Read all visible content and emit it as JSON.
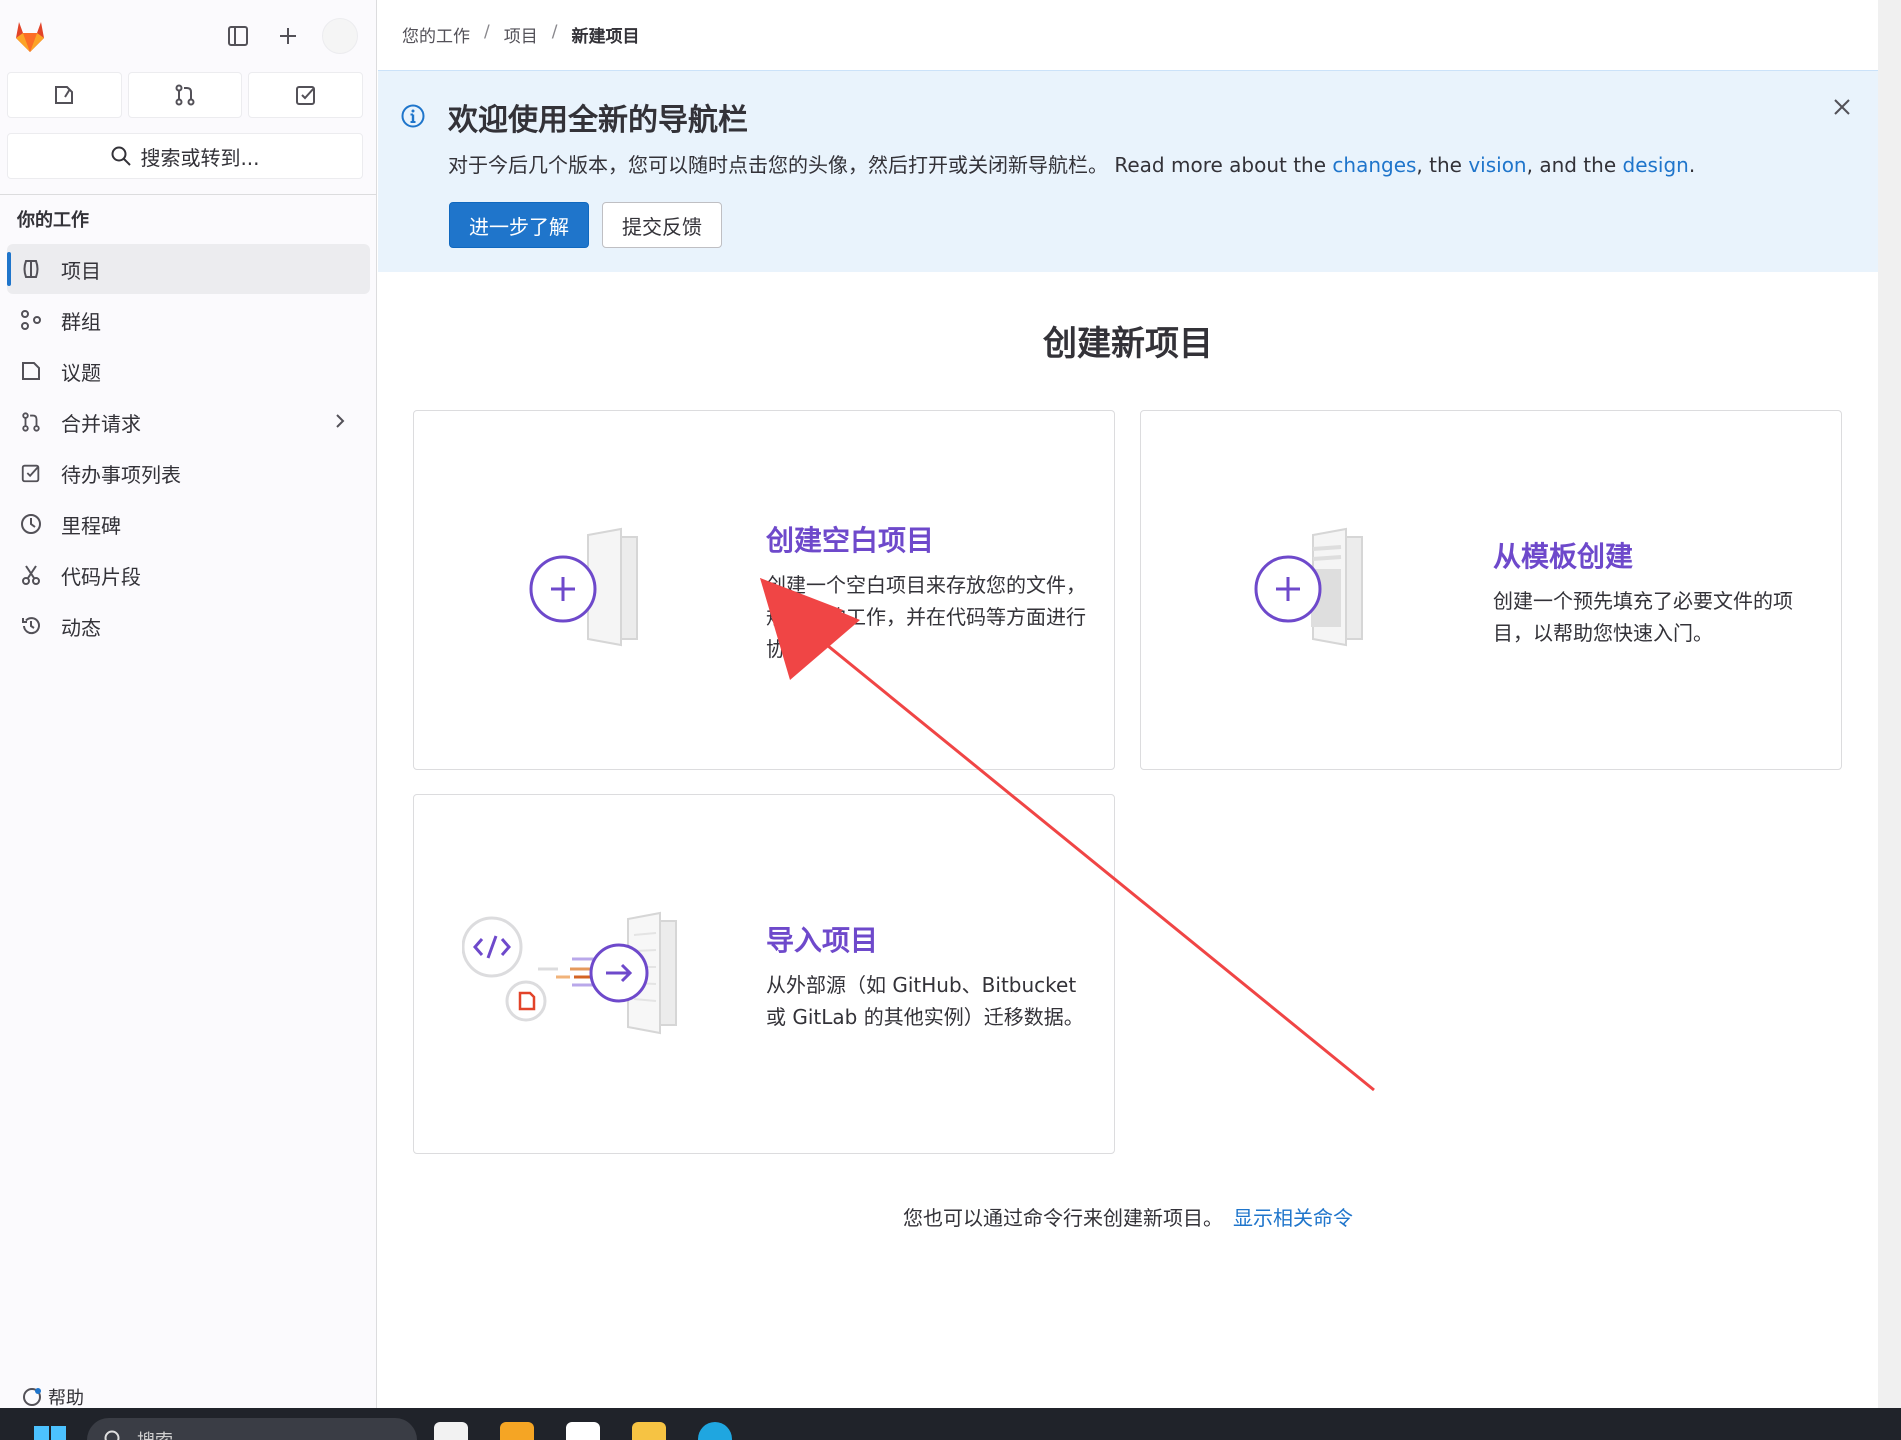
{
  "sidebar": {
    "search_label": "搜索或转到...",
    "section_title": "你的工作",
    "items": [
      {
        "label": "项目",
        "icon": "project-icon",
        "active": true
      },
      {
        "label": "群组",
        "icon": "group-icon"
      },
      {
        "label": "议题",
        "icon": "issues-icon"
      },
      {
        "label": "合并请求",
        "icon": "merge-request-icon",
        "has_chevron": true
      },
      {
        "label": "待办事项列表",
        "icon": "todo-icon"
      },
      {
        "label": "里程碑",
        "icon": "milestone-icon"
      },
      {
        "label": "代码片段",
        "icon": "snippet-icon"
      },
      {
        "label": "动态",
        "icon": "activity-icon"
      }
    ],
    "help_label": "帮助"
  },
  "breadcrumb": {
    "items": [
      "您的工作",
      "项目",
      "新建项目"
    ]
  },
  "banner": {
    "title": "欢迎使用全新的导航栏",
    "text_cn": "对于今后几个版本，您可以随时点击您的头像，然后打开或关闭新导航栏。",
    "text_en_1": "Read more about the",
    "link_changes": "changes",
    "text_en_2": ", the",
    "link_vision": "vision",
    "text_en_3": ", and the",
    "link_design": "design",
    "text_en_4": ".",
    "primary_button": "进一步了解",
    "secondary_button": "提交反馈"
  },
  "page_title": "创建新项目",
  "cards": [
    {
      "title": "创建空白项目",
      "desc": [
        "创建一个空白项目来存放您的文件，",
        "规划您的工作，并在代码等方面进行",
        "协作。"
      ]
    },
    {
      "title": "从模板创建",
      "desc": [
        "创建一个预先填充了必要文件的项",
        "目，以帮助您快速入门。"
      ]
    },
    {
      "title": "导入项目",
      "desc": [
        "从外部源（如 GitHub、Bitbucket",
        "或 GitLab 的其他实例）迁移数据。"
      ]
    }
  ],
  "cli": {
    "text": "您也可以通过命令行来创建新项目。",
    "link": "显示相关命令"
  },
  "taskbar": {
    "search_placeholder": "搜索"
  },
  "colors": {
    "accent_blue": "#1f75cb",
    "purple": "#6e49cb",
    "banner_bg": "#e9f3fc",
    "arrow_red": "#f04545"
  }
}
